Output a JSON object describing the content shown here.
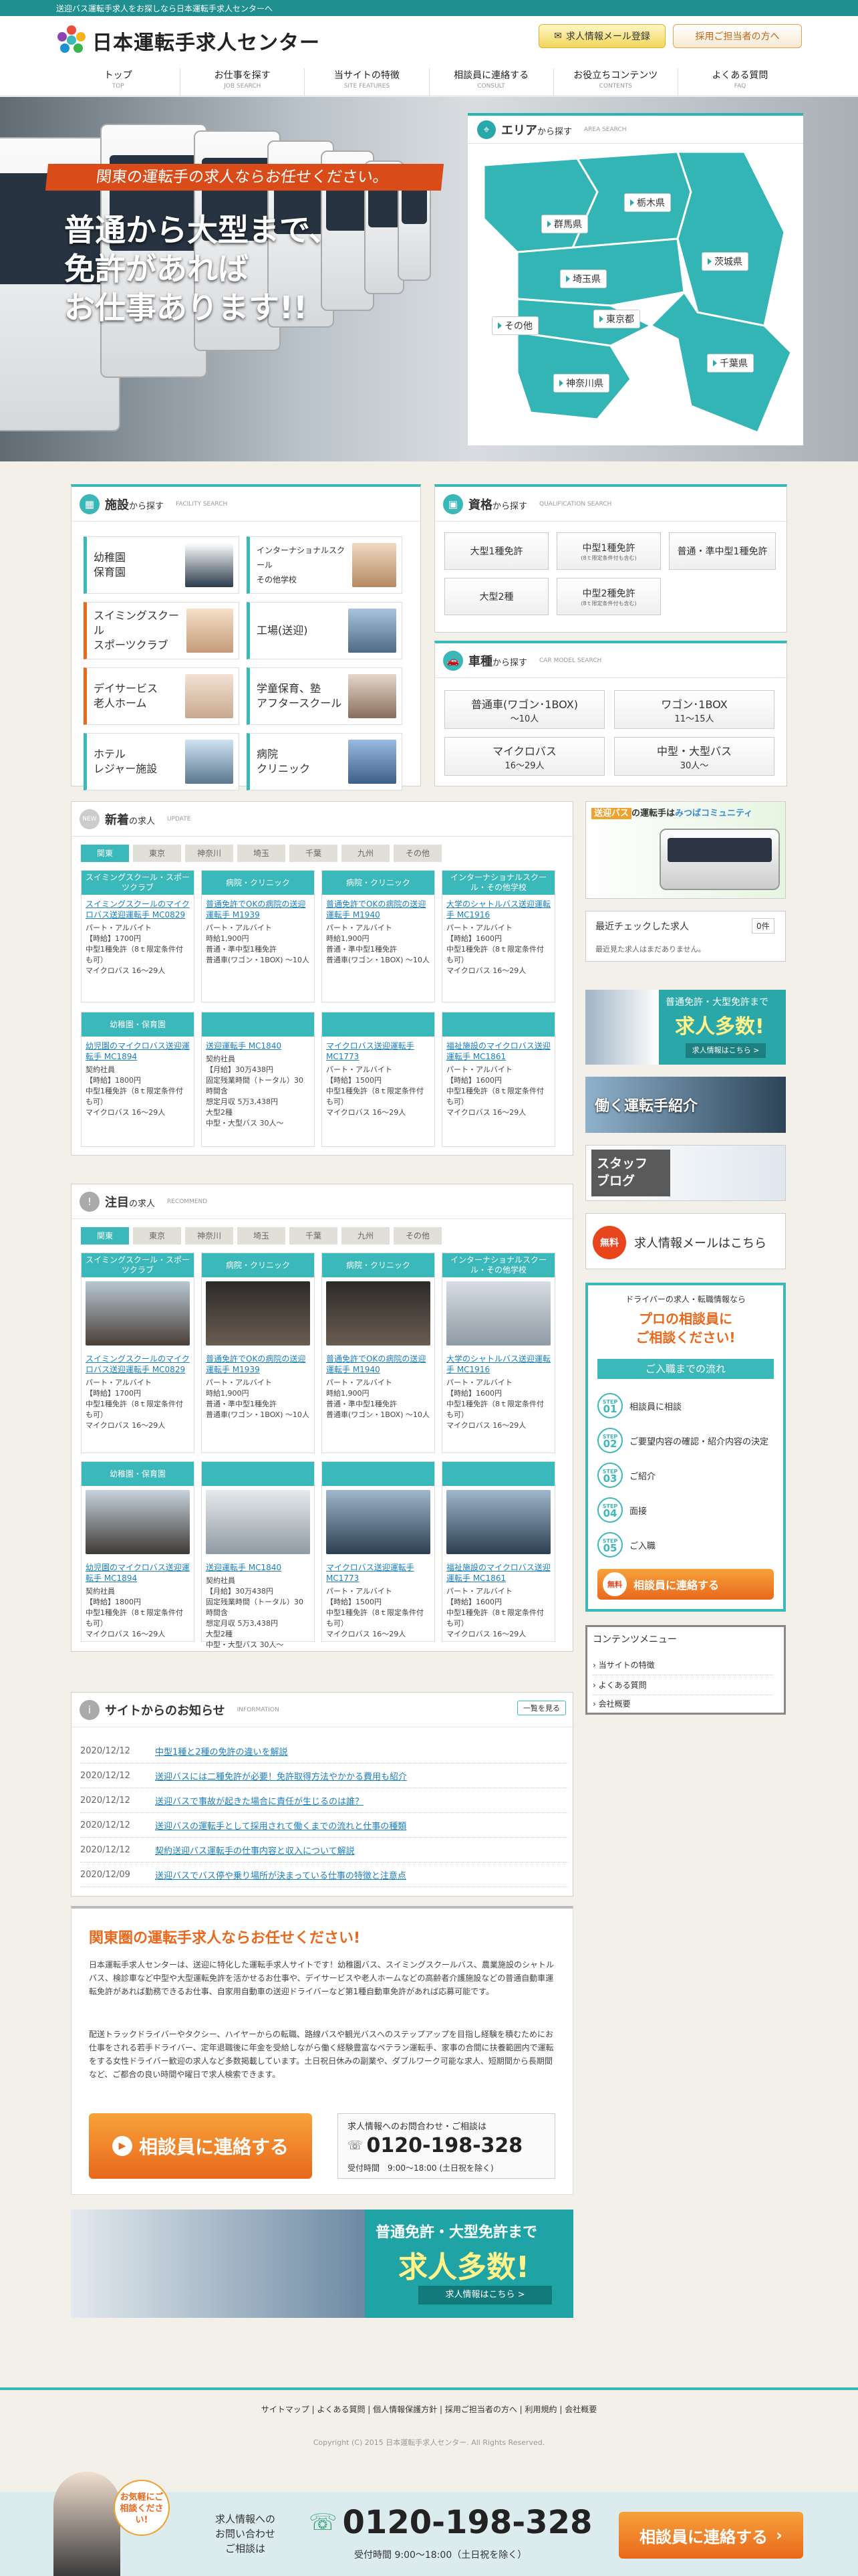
{
  "topbar": {
    "text": "送迎バス運転手求人をお探しなら日本運転手求人センターへ"
  },
  "header": {
    "logo": "日本運転手求人センター",
    "btn_mail": "求人情報メール登録",
    "btn_recruit": "採用ご担当者の方へ"
  },
  "nav": [
    {
      "label": "トップ",
      "en": "TOP"
    },
    {
      "label": "お仕事を探す",
      "en": "JOB SEARCH"
    },
    {
      "label": "当サイトの特徴",
      "en": "SITE FEATURES"
    },
    {
      "label": "相談員に連絡する",
      "en": "CONSULT"
    },
    {
      "label": "お役立ちコンテンツ",
      "en": "CONTENTS"
    },
    {
      "label": "よくある質問",
      "en": "FAQ"
    }
  ],
  "hero": {
    "ribbon": "関東の運転手の求人ならお任せください。",
    "line1": "普通から大型まで、",
    "line2": "免許があれば",
    "line3": "お仕事あります!!"
  },
  "area": {
    "title": "エリア",
    "title_suffix": "から探す",
    "en": "AREA SEARCH",
    "prefs": [
      "群馬県",
      "栃木県",
      "茨城県",
      "埼玉県",
      "東京都",
      "千葉県",
      "その他",
      "神奈川県"
    ]
  },
  "facility": {
    "title": "施設",
    "title_suffix": "から探す",
    "en": "FACILITY SEARCH",
    "items": [
      "幼稚園\n保育園",
      "インターナショナルスクール\nその他学校",
      "スイミングスクール\nスポーツクラブ",
      "工場(送迎)",
      "デイサービス\n老人ホーム",
      "学童保育、塾\nアフタースクール",
      "ホテル\nレジャー施設",
      "病院\nクリニック"
    ]
  },
  "license": {
    "title": "資格",
    "title_suffix": "から探す",
    "en": "QUALIFICATION SEARCH",
    "items": [
      {
        "l": "大型1種免許",
        "s": ""
      },
      {
        "l": "中型1種免許",
        "s": "(8ｔ限定条件付も含む)"
      },
      {
        "l": "普通・準中型1種免許",
        "s": ""
      },
      {
        "l": "大型2種",
        "s": ""
      },
      {
        "l": "中型2種免許",
        "s": "(8ｔ限定条件付も含む)"
      }
    ]
  },
  "vehicle": {
    "title": "車種",
    "title_suffix": "から探す",
    "en": "CAR MODEL SEARCH",
    "items": [
      {
        "l": "普通車(ワゴン･1BOX)",
        "s": "〜10人"
      },
      {
        "l": "ワゴン･1BOX",
        "s": "11〜15人"
      },
      {
        "l": "マイクロバス",
        "s": "16〜29人"
      },
      {
        "l": "中型・大型バス",
        "s": "30人〜"
      }
    ]
  },
  "new_jobs": {
    "title": "新着",
    "title_suffix": "の求人",
    "en": "UPDATE"
  },
  "rec_jobs": {
    "title": "注目",
    "title_suffix": "の求人",
    "en": "RECOMMEND"
  },
  "tabs": [
    "関東",
    "東京",
    "神奈川",
    "埼玉",
    "千葉",
    "九州",
    "その他"
  ],
  "jobs": [
    {
      "cat": "スイミングスクール・スポーツクラブ",
      "title": "スイミングスクールのマイクロバス送迎運転手 MC0829",
      "body": "パート・アルバイト\n【時給】1700円\n中型1種免許（8ｔ限定条件付も可）\nマイクロバス 16〜29人"
    },
    {
      "cat": "病院・クリニック",
      "title": "普通免許でOKの病院の送迎運転手 M1939",
      "body": "パート・アルバイト\n時給1,900円\n普通・準中型1種免許\n普通車(ワゴン・1BOX) 〜10人"
    },
    {
      "cat": "病院・クリニック",
      "title": "普通免許でOKの病院の送迎運転手 M1940",
      "body": "パート・アルバイト\n時給1,900円\n普通・準中型1種免許\n普通車(ワゴン・1BOX) 〜10人"
    },
    {
      "cat": "インターナショナルスクール・その他学校",
      "title": "大学のシャトルバス送迎運転手 MC1916",
      "body": "パート・アルバイト\n【時給】1600円\n中型1種免許（8ｔ限定条件付も可）\nマイクロバス 16〜29人"
    },
    {
      "cat": "幼稚園・保育園",
      "title": "幼児園のマイクロバス送迎運転手 MC1894",
      "body": "契約社員\n【時給】1800円\n中型1種免許（8ｔ限定条件付も可）\nマイクロバス 16〜29人"
    },
    {
      "cat": "",
      "title": "送迎運転手 MC1840",
      "body": "契約社員\n【月給】30万438円\n固定残業時間（トータル）30時間含\n想定月収 5万3,438円\n大型2種\n中型・大型バス 30人〜"
    },
    {
      "cat": "",
      "title": "マイクロバス送迎運転手 MC1773",
      "body": "パート・アルバイト\n【時給】1500円\n中型1種免許（8ｔ限定条件付も可）\nマイクロバス 16〜29人"
    },
    {
      "cat": "",
      "title": "福祉施設のマイクロバス送迎運転手 MC1861",
      "body": "パート・アルバイト\n【時給】1600円\n中型1種免許（8ｔ限定条件付も可）\nマイクロバス 16〜29人"
    }
  ],
  "sidebar": {
    "banner1_a": "送迎バス",
    "banner1_b": "の運転手は",
    "banner1_c": "みつばコミュニティ",
    "recent_title": "最近チェックした求人",
    "recent_count": "0件",
    "recent_empty": "最近見た求人はまだありません。",
    "banner2_a": "普通免許・大型免許まで",
    "banner2_b": "求人多数!",
    "banner2_c": "求人情報はこちら >",
    "banner3": "働く運転手紹介",
    "banner4_a": "スタッフ",
    "banner4_b": "ブログ",
    "mail_free": "無料",
    "mail_text": "求人情報メールはこちら",
    "consult_lead": "ドライバーの求人・転職情報なら",
    "consult_big1": "プロの相談員に",
    "consult_big2": "ご相談ください!",
    "flow_title": "ご入職までの流れ",
    "steps": [
      "相談員に相談",
      "ご要望内容の確認・紹介内容の決定",
      "ご紹介",
      "面接",
      "ご入職"
    ],
    "consult_free": "無料",
    "consult_btn": "相談員に連絡する",
    "menu_title": "コンテンツメニュー",
    "menu": [
      "当サイトの特徴",
      "よくある質問",
      "会社概要"
    ]
  },
  "news": {
    "title": "サイトからのお知らせ",
    "en": "INFORMATION",
    "more": "一覧を見る",
    "items": [
      {
        "d": "2020/12/12",
        "t": "中型1種と2種の免許の違いを解説"
      },
      {
        "d": "2020/12/12",
        "t": "送迎バスには二種免許が必要！免許取得方法やかかる費用も紹介"
      },
      {
        "d": "2020/12/12",
        "t": "送迎バスで事故が起きた場合に責任が生じるのは誰？"
      },
      {
        "d": "2020/12/12",
        "t": "送迎バスの運転手として採用されて働くまでの流れと仕事の種類"
      },
      {
        "d": "2020/12/12",
        "t": "契約送迎バス運転手の仕事内容と収入について解説"
      },
      {
        "d": "2020/12/09",
        "t": "送迎バスでバス停や乗り場所が決まっている仕事の特徴と注意点"
      }
    ]
  },
  "about": {
    "title": "関東圏の運転手求人ならお任せください!",
    "p1": "日本運転手求人センターは、送迎に特化した運転手求人サイトです！幼稚園バス、スイミングスクールバス、農業施設のシャトルバス、検診車など中型や大型運転免許を活かせるお仕事や、デイサービスや老人ホームなどの高齢者介護施設などの普通自動車運転免許があれば勤務できるお仕事、自家用自動車の送迎ドライバーなど第1種自動車免許があれば応募可能です。",
    "p2": "配送トラックドライバーやタクシー、ハイヤーからの転職、路線バスや観光バスへのステップアップを目指し経験を積むためにお仕事をされる若手ドライバー、定年退職後に年金を受給しながら働く経験豊富なベテラン運転手、家事の合間に扶養範囲内で運転をする女性ドライバー歓迎の求人など多数掲載しています。土日祝日休みの副業や、ダブルワーク可能な求人、短期間から長期間など、ご都合の良い時間や曜日で求人検索できます。",
    "cta_btn": "相談員に連絡する",
    "tel_lead": "求人情報へのお問合わせ・ご相談は",
    "tel": "0120-198-328",
    "hours_label": "受付時間",
    "hours": "9:00〜18:00 (土日祝を除く)"
  },
  "bigbanner": {
    "a": "普通免許・大型免許まで",
    "b": "求人多数!",
    "c": "求人情報はこちら >"
  },
  "footer": {
    "links": [
      "サイトマップ",
      "よくある質問",
      "個人情報保護方針",
      "採用ご担当者の方へ",
      "利用規約",
      "会社概要"
    ],
    "copy": "Copyright (C) 2015 日本運転手求人センター. All Rights Reserved."
  },
  "ctabar": {
    "bubble": "お気軽にご相談ください!",
    "lead1": "求人情報への",
    "lead2": "お問い合わせ",
    "lead3": "ご相談は",
    "tel": "0120-198-328",
    "hours": "受付時間 9:00〜18:00（土日祝を除く）",
    "btn": "相談員に連絡する"
  },
  "colors": {
    "teal": "#3bb8b9",
    "orange": "#e8681c",
    "red": "#d94c1a"
  }
}
